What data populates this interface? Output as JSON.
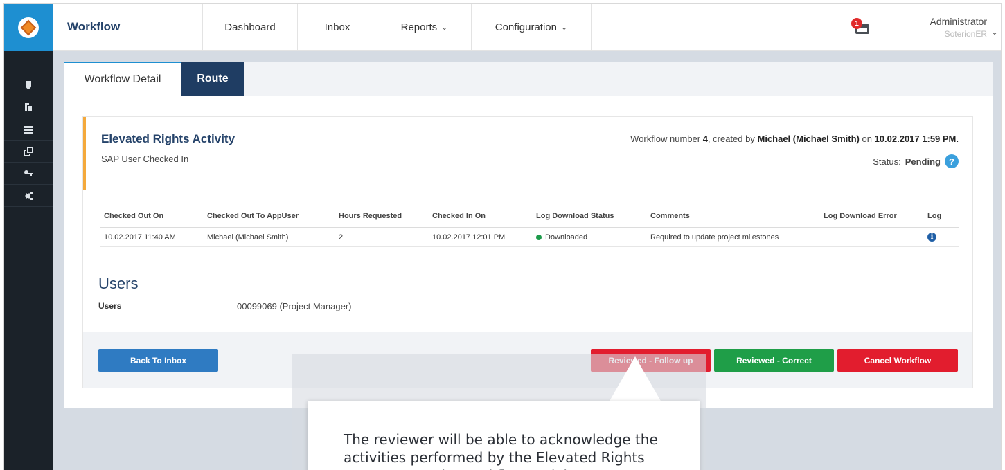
{
  "app": {
    "brand": "Workflow",
    "logo_icon": "app-logo-icon"
  },
  "nav": {
    "items": [
      {
        "label": "Dashboard",
        "has_dropdown": false
      },
      {
        "label": "Inbox",
        "has_dropdown": false
      },
      {
        "label": "Reports",
        "has_dropdown": true
      },
      {
        "label": "Configuration",
        "has_dropdown": true
      }
    ]
  },
  "notifications": {
    "count": "1",
    "icon": "inbox-tray-icon"
  },
  "user": {
    "name": "Administrator",
    "org": "SoterionER"
  },
  "sidebar": {
    "icons": [
      "shield-icon",
      "documents-icon",
      "server-icon",
      "copy-icon",
      "key-icon",
      "settings-icon"
    ]
  },
  "tabs": {
    "detail": "Workflow Detail",
    "route": "Route"
  },
  "activity": {
    "title": "Elevated Rights Activity",
    "subtitle": "SAP User Checked In",
    "info_prefix": "Workflow number",
    "number": "4",
    "created_by_text": ", created by",
    "creator": "Michael (Michael Smith)",
    "on_text": "on",
    "created_at": "10.02.2017 1:59 PM.",
    "status_label": "Status:",
    "status_value": "Pending",
    "help_symbol": "?"
  },
  "log_table": {
    "headers": [
      "Checked Out On",
      "Checked Out To AppUser",
      "Hours Requested",
      "Checked In On",
      "Log Download Status",
      "Comments",
      "Log Download Error",
      "Log"
    ],
    "rows": [
      {
        "checked_out_on": "10.02.2017 11:40 AM",
        "checked_out_to": "Michael (Michael Smith)",
        "hours": "2",
        "checked_in_on": "10.02.2017 12:01 PM",
        "status": "Downloaded",
        "comments": "Required to update project milestones",
        "error": "",
        "log_symbol": "i"
      }
    ]
  },
  "users_section": {
    "heading": "Users",
    "label": "Users",
    "value": "00099069 (Project Manager)"
  },
  "buttons": {
    "back": "Back To Inbox",
    "follow_up": "Reviewed - Follow up",
    "correct": "Reviewed - Correct",
    "cancel": "Cancel Workflow"
  },
  "callout": {
    "text": "The reviewer will be able to acknowledge the activities performed by the Elevated Rights Access user. The workflow activity"
  },
  "colors": {
    "sidebar": "#1b2229",
    "brand_blue": "#1e8fd1",
    "navy": "#25436a",
    "route_tab": "#1f3d63",
    "accent_orange": "#f4a93c",
    "red": "#e21d2e",
    "green": "#1f9e48",
    "blue_button": "#2f7bc2"
  }
}
